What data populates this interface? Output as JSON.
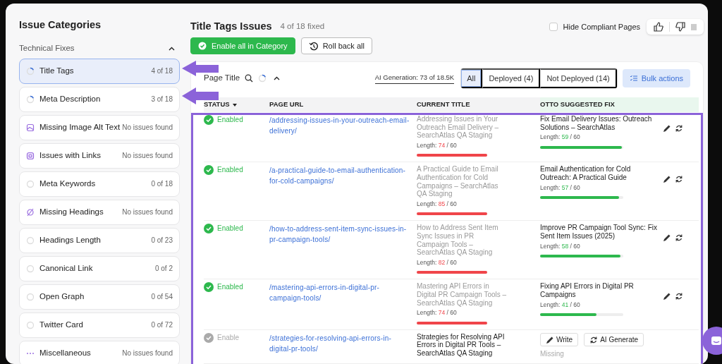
{
  "sidebar": {
    "title": "Issue Categories",
    "section": {
      "label": "Technical Fixes",
      "expanded": true
    },
    "items": [
      {
        "label": "Title Tags",
        "count": "4 of 18",
        "kind": "in-progress",
        "selected": true
      },
      {
        "label": "Meta Description",
        "count": "3 of 18",
        "kind": "in-progress",
        "selected": false
      },
      {
        "label": "Missing Image Alt Text",
        "count": "No issues found",
        "kind": "image",
        "selected": false
      },
      {
        "label": "Issues with Links",
        "count": "No issues found",
        "kind": "links",
        "selected": false
      },
      {
        "label": "Meta Keywords",
        "count": "0 of 18",
        "kind": "not-started",
        "selected": false
      },
      {
        "label": "Missing Headings",
        "count": "No issues found",
        "kind": "headings",
        "selected": false
      },
      {
        "label": "Headings Length",
        "count": "0 of 23",
        "kind": "not-started",
        "selected": false
      },
      {
        "label": "Canonical Link",
        "count": "0 of 2",
        "kind": "not-started",
        "selected": false
      },
      {
        "label": "Open Graph",
        "count": "0 of 54",
        "kind": "not-started",
        "selected": false
      },
      {
        "label": "Twitter Card",
        "count": "0 of 72",
        "kind": "not-started",
        "selected": false
      },
      {
        "label": "Miscellaneous",
        "count": "No issues found",
        "kind": "misc",
        "selected": false
      }
    ]
  },
  "header": {
    "title": "Title Tags Issues",
    "progress": "4 of 18 fixed",
    "hide_compliant": {
      "label": "Hide Compliant Pages",
      "checked": false
    }
  },
  "actions": [
    {
      "label": "Enable all in Category",
      "kind": "primary"
    },
    {
      "label": "Roll back all",
      "kind": "secondary"
    }
  ],
  "toolbar": {
    "column_label": "Page Title",
    "expanded": true,
    "ai_generation": "AI Generation: 73 of 18.5K",
    "filters": [
      {
        "label": "All",
        "selected": true
      },
      {
        "label": "Deployed (4)",
        "selected": false
      },
      {
        "label": "Not Deployed (14)",
        "selected": false
      }
    ],
    "bulk_action": "Bulk actions"
  },
  "table": {
    "columns": [
      {
        "label": "STATUS",
        "sortable": true
      },
      {
        "label": "PAGE URL",
        "sortable": false
      },
      {
        "label": "CURRENT TITLE",
        "sortable": false
      },
      {
        "label": "OTTO SUGGESTED FIX",
        "sortable": false
      }
    ],
    "rows": [
      {
        "status": "Enabled",
        "enabled": true,
        "url": "/addressing-issues-in-your-outreach-email-delivery/",
        "current_title": "Addressing Issues in Your Outreach Email Delivery – SearchAtlas QA Staging",
        "current_length": {
          "label": "Length:",
          "value": "74",
          "max": "/ 60",
          "over_limit": true,
          "level": 1
        },
        "kind": "suggested",
        "suggested_fix": "Fix Email Delivery Issues: Outreach Solutions – SearchAtlas",
        "fix_length": {
          "label": "Length:",
          "value": "59",
          "max": "/ 60",
          "over_limit": false,
          "level": 0.98
        }
      },
      {
        "status": "Enabled",
        "enabled": true,
        "url": "/a-practical-guide-to-email-authentication-for-cold-campaigns/",
        "current_title": "A Practical Guide to Email Authentication for Cold Campaigns – SearchAtlas QA Staging",
        "current_length": {
          "label": "Length:",
          "value": "85",
          "max": "/ 60",
          "over_limit": true,
          "level": 1
        },
        "kind": "suggested",
        "suggested_fix": "Email Authentication for Cold Outreach: A Practical Guide",
        "fix_length": {
          "label": "Length:",
          "value": "57",
          "max": "/ 60",
          "over_limit": false,
          "level": 0.95
        }
      },
      {
        "status": "Enabled",
        "enabled": true,
        "url": "/how-to-address-sent-item-sync-issues-in-pr-campaign-tools/",
        "current_title": "How to Address Sent Item Sync Issues in PR Campaign Tools – SearchAtlas QA Staging",
        "current_length": {
          "label": "Length:",
          "value": "82",
          "max": "/ 60",
          "over_limit": true,
          "level": 1
        },
        "kind": "suggested",
        "suggested_fix": "Improve PR Campaign Tool Sync: Fix Sent Item Issues (2025)",
        "fix_length": {
          "label": "Length:",
          "value": "58",
          "max": "/ 60",
          "over_limit": false,
          "level": 0.97
        }
      },
      {
        "status": "Enabled",
        "enabled": true,
        "url": "/mastering-api-errors-in-digital-pr-campaign-tools/",
        "current_title": "Mastering API Errors in Digital PR Campaign Tools – SearchAtlas QA Staging",
        "current_length": {
          "label": "Length:",
          "value": "74",
          "max": "/ 60",
          "over_limit": true,
          "level": 1
        },
        "kind": "suggested",
        "suggested_fix": "Fixing API Errors in Digital PR Campaigns",
        "fix_length": {
          "label": "Length:",
          "value": "41",
          "max": "/ 60",
          "over_limit": false,
          "level": 0.68
        }
      },
      {
        "status": "Enable",
        "enabled": false,
        "url": "/strategies-for-resolving-api-errors-in-digital-pr-tools/",
        "current_title": "Strategies for Resolving API Errors in Digital PR Tools – SearchAtlas QA Staging",
        "kind": "missing",
        "fix_buttons": [
          "Write",
          "AI Generate"
        ],
        "fix_note": "Missing"
      }
    ]
  }
}
